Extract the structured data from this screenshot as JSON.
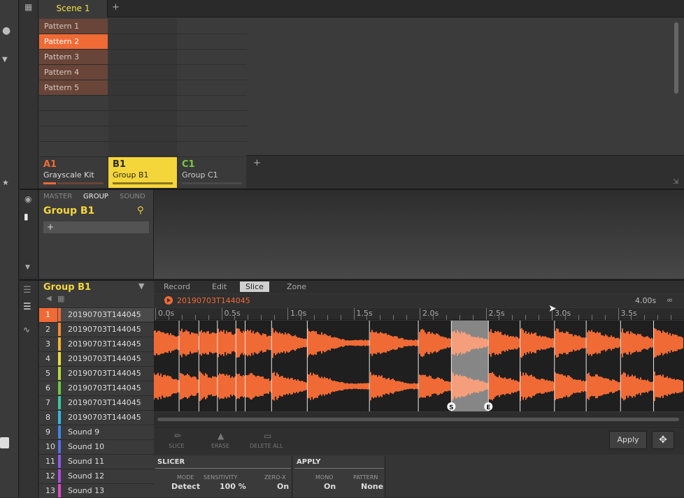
{
  "scene_header": {
    "scene_label": "Scene 1",
    "add_label": "+"
  },
  "patterns": [
    "Pattern 1",
    "Pattern 2",
    "Pattern 3",
    "Pattern 4",
    "Pattern 5"
  ],
  "selected_pattern_index": 1,
  "groups": [
    {
      "letter": "A1",
      "name": "Grayscale Kit"
    },
    {
      "letter": "B1",
      "name": "Group B1"
    },
    {
      "letter": "C1",
      "name": "Group C1"
    }
  ],
  "group_add_label": "+",
  "plugin_panel": {
    "tabs": [
      "MASTER",
      "GROUP",
      "SOUND"
    ],
    "title": "Group B1",
    "slot_label": "+"
  },
  "sound_list": {
    "title": "Group B1",
    "sounds": [
      {
        "num": "1",
        "name": "20190703T144045",
        "color": "#f06a35"
      },
      {
        "num": "2",
        "name": "20190703T144045",
        "color": "#f08a30"
      },
      {
        "num": "3",
        "name": "20190703T144045",
        "color": "#f5b530"
      },
      {
        "num": "4",
        "name": "20190703T144045",
        "color": "#e8e040"
      },
      {
        "num": "5",
        "name": "20190703T144045",
        "color": "#b8d83a"
      },
      {
        "num": "6",
        "name": "20190703T144045",
        "color": "#6cc840"
      },
      {
        "num": "7",
        "name": "20190703T144045",
        "color": "#3ac8a0"
      },
      {
        "num": "8",
        "name": "20190703T144045",
        "color": "#38b8e0"
      },
      {
        "num": "9",
        "name": "Sound 9",
        "color": "#3a8ae8"
      },
      {
        "num": "10",
        "name": "Sound 10",
        "color": "#5a6ae8"
      },
      {
        "num": "11",
        "name": "Sound 11",
        "color": "#8a5ae8"
      },
      {
        "num": "12",
        "name": "Sound 12",
        "color": "#b04ae0"
      },
      {
        "num": "13",
        "name": "Sound 13",
        "color": "#d84ac8"
      }
    ]
  },
  "editor": {
    "tabs": [
      "Record",
      "Edit",
      "Slice",
      "Zone"
    ],
    "active_tab": "Slice",
    "sample_name": "20190703T144045",
    "duration": "4.00s",
    "ruler_labels": [
      "0.0s",
      "0.5s",
      "1.0s",
      "1.5s",
      "2.0s",
      "2.5s",
      "3.0s",
      "3.5s"
    ],
    "ruler_step_seconds": 0.5,
    "total_seconds": 4.2,
    "slice_points_seconds": [
      0.18,
      0.33,
      0.47,
      0.61,
      0.68,
      0.88,
      1.15,
      1.62,
      1.99,
      2.24,
      2.52,
      2.76,
      3.02,
      3.26,
      3.52,
      3.77,
      4.05
    ],
    "selected_slice_seconds": [
      2.24,
      2.52
    ],
    "slice_markers": [
      "S",
      "E"
    ],
    "tools": [
      "SLICE",
      "ERASE",
      "DELETE ALL"
    ],
    "apply_label": "Apply",
    "waveform_color": "#f06a35"
  },
  "slicer": {
    "title": "SLICER",
    "params": [
      {
        "label": "MODE",
        "value": "Detect"
      },
      {
        "label": "SENSITIVITY",
        "value": "100 %"
      },
      {
        "label": "ZERO-X",
        "value": "On"
      }
    ]
  },
  "apply_section": {
    "title": "APPLY",
    "params": [
      {
        "label": "MONO",
        "value": "On"
      },
      {
        "label": "PATTERN",
        "value": "None"
      }
    ]
  }
}
